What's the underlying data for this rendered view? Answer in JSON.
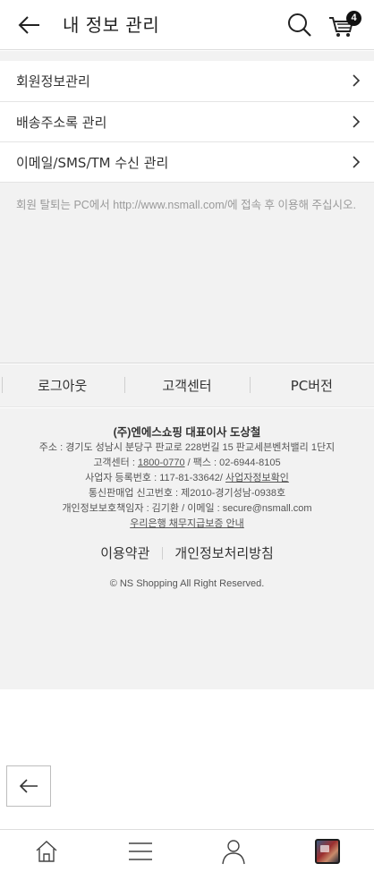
{
  "header": {
    "title": "내 정보 관리",
    "cart_count": "4"
  },
  "menu": [
    {
      "label": "회원정보관리"
    },
    {
      "label": "배송주소록 관리"
    },
    {
      "label": "이메일/SMS/TM 수신 관리"
    }
  ],
  "notice": "회원 탈퇴는 PC에서 http://www.nsmall.com/에 접속 후 이용해 주십시오.",
  "quick_links": [
    "로그아웃",
    "고객센터",
    "PC버전"
  ],
  "footer": {
    "company": "(주)엔에스쇼핑 대표이사 도상철",
    "address": "주소 : 경기도 성남시 분당구 판교로 228번길 15 판교세븐벤처밸리 1단지",
    "cs_prefix": "고객센터 : ",
    "cs_phone": "1800-0770",
    "fax": " / 팩스 : 02-6944-8105",
    "biz_no": "사업자 등록번호 : 117-81-33642/ ",
    "biz_check": "사업자정보확인",
    "telesales": "통신판매업 신고번호 : 제2010-경기성남-0938호",
    "privacy_officer": "개인정보보호책임자 : 김기환 / 이메일 : secure@nsmall.com",
    "escrow": "우리은행 채무지급보증 안내",
    "terms": "이용약관",
    "privacy_policy": "개인정보처리방침",
    "copyright": "© NS Shopping All Right Reserved."
  },
  "icons": {
    "back": "arrow-left-icon",
    "search": "search-icon",
    "cart": "cart-icon",
    "chevron": "chevron-right-icon",
    "home": "home-icon",
    "menu": "hamburger-icon",
    "person": "person-icon"
  }
}
